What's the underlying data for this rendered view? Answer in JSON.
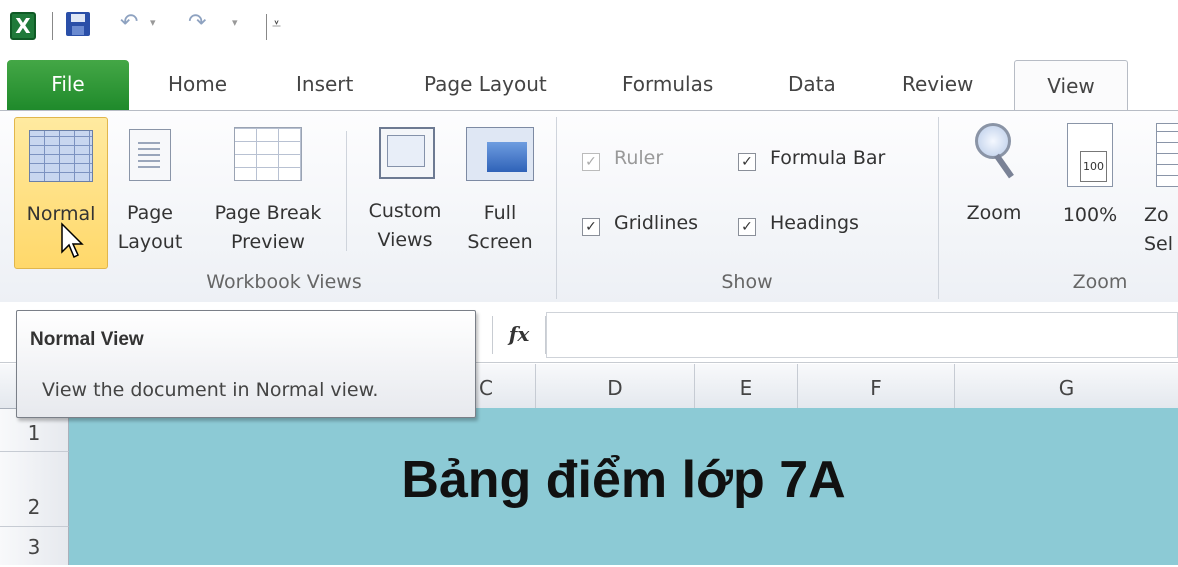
{
  "qat": {
    "excel_icon": "X",
    "icons": [
      "excel-icon",
      "save-icon",
      "undo-icon",
      "redo-icon",
      "customize-qat-icon"
    ]
  },
  "tabs": {
    "file": "File",
    "home": "Home",
    "insert": "Insert",
    "page_layout": "Page Layout",
    "formulas": "Formulas",
    "data": "Data",
    "review": "Review",
    "view": "View"
  },
  "ribbon": {
    "workbook_views": {
      "label": "Workbook Views",
      "normal": "Normal",
      "page_layout_1": "Page",
      "page_layout_2": "Layout",
      "page_break_1": "Page Break",
      "page_break_2": "Preview",
      "custom_1": "Custom",
      "custom_2": "Views",
      "full_1": "Full",
      "full_2": "Screen"
    },
    "show": {
      "label": "Show",
      "ruler": "Ruler",
      "gridlines": "Gridlines",
      "formula_bar": "Formula Bar",
      "headings": "Headings"
    },
    "zoom": {
      "label": "Zoom",
      "zoom": "Zoom",
      "pct": "100%",
      "pct_icon": "100",
      "zoom_sel_1": "Zo",
      "zoom_sel_2": "Sel"
    }
  },
  "formula_bar": {
    "fx": "fx"
  },
  "tooltip": {
    "title": "Normal View",
    "description": "View the document in Normal view."
  },
  "columns": [
    "C",
    "D",
    "E",
    "F",
    "G"
  ],
  "rows": [
    "1",
    "2",
    "3"
  ],
  "sheet": {
    "title": "Bảng điểm lớp 7A",
    "title_bg": "#8ccad5"
  },
  "colors": {
    "file_tab": "#2e9a3a",
    "selected_button": "#ffd86a"
  }
}
